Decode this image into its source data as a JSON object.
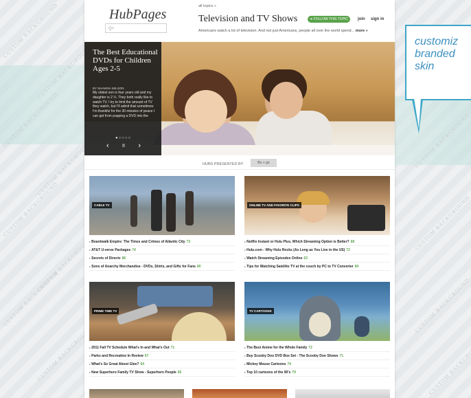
{
  "header": {
    "logo": "HubPages",
    "search_placeholder": "Q+",
    "crumb": "all topics »",
    "topic_title": "Television and TV Shows",
    "follow_label": "➜ FOLLOW THIS TOPIC",
    "join_label": "join",
    "signin_label": "sign in",
    "description": "Americans watch a lot of television. And not just Americans, people all over the world spend...",
    "more_label": "more »"
  },
  "hero": {
    "title": "The Best Educational DVDs for Children Ages 2-5",
    "byline": "BY SHAWNA WILSON",
    "body": "My oldest son is four years old and my daughter is 2 ½. They both really like to watch TV. I try to limit the amount of TV they watch, but I'll admit that sometimes I'm thankful for the 30 minutes of peace I can get from popping a DVD into the",
    "dots": "●○○○○",
    "prev": "‹",
    "pause": "II",
    "next": "›"
  },
  "presented": {
    "label": "HUBS PRESENTED BY",
    "sponsor": "Bo + go"
  },
  "cards": [
    {
      "tag": "CABLE TV",
      "items": [
        {
          "text": "Boardwalk Empire: The Times and Crimes of Atlantic City",
          "n": "73"
        },
        {
          "text": "AT&T U-verse Packages",
          "n": "74"
        },
        {
          "text": "Secrets of Directv",
          "n": "86"
        },
        {
          "text": "Sons of Anarchy Merchandise - DVDs, Shirts, and Gifts for Fans",
          "n": "80"
        }
      ]
    },
    {
      "tag": "ONLINE TV AND FAVORITE CLIPS",
      "items": [
        {
          "text": "Netflix Instant or Hulu Plus, Which Streaming Option is Better?",
          "n": "68"
        },
        {
          "text": "Hulu.com - Why Hulu Rocks (As Long as You Live in the US)",
          "n": "72"
        },
        {
          "text": "Watch Streaming Episodes Online",
          "n": "63"
        },
        {
          "text": "Tips for Watching Satellite TV at the couch by PC to TV Converter",
          "n": "84"
        }
      ]
    },
    {
      "tag": "PRIME TIME TV",
      "items": [
        {
          "text": "2011 Fall TV Schedule What's In and What's Out",
          "n": "71"
        },
        {
          "text": "Parks and Recreation In Review",
          "n": "67"
        },
        {
          "text": "What's So Great About Glee?",
          "n": "64"
        },
        {
          "text": "New Superhero Family TV Show - Superhero People",
          "n": "65"
        }
      ]
    },
    {
      "tag": "TV CARTOONS",
      "items": [
        {
          "text": "The Best Anime for the Whole Family",
          "n": "72"
        },
        {
          "text": "Buy Scooby Doo DVD Box Set - The Scooby Doo Shows",
          "n": "71"
        },
        {
          "text": "Mickey Mouse Cartoons",
          "n": "74"
        },
        {
          "text": "Top 10 cartoons of the 90's",
          "n": "79"
        }
      ]
    }
  ],
  "callout": {
    "line1": "customiz",
    "line2": "branded",
    "line3": "skin"
  },
  "watermark": "CUSTOM BACKGROUND",
  "colors": {
    "accent_green": "#5aa34b",
    "callout_blue": "#3ea6c8"
  }
}
